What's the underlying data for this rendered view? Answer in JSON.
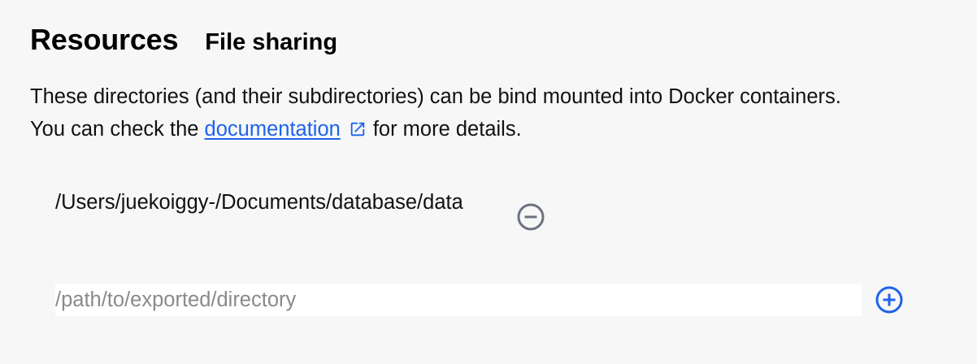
{
  "header": {
    "title": "Resources",
    "subtitle": "File sharing"
  },
  "description": {
    "before_link": "These directories (and their subdirectories) can be bind mounted into Docker containers. You can check the ",
    "link_text": "documentation",
    "after_link": "for more details."
  },
  "shared_paths": [
    {
      "path": "/Users/juekoiggy-/Documents/database/data",
      "remove_icon": "minus-circle-icon"
    }
  ],
  "new_path": {
    "value": "",
    "placeholder": "/path/to/exported/directory",
    "add_icon": "plus-circle-icon"
  },
  "colors": {
    "background": "#f7f7f7",
    "link": "#1d63ed",
    "remove_icon": "#6b7280",
    "add_icon": "#1d63ed",
    "input_background": "#ffffff"
  }
}
